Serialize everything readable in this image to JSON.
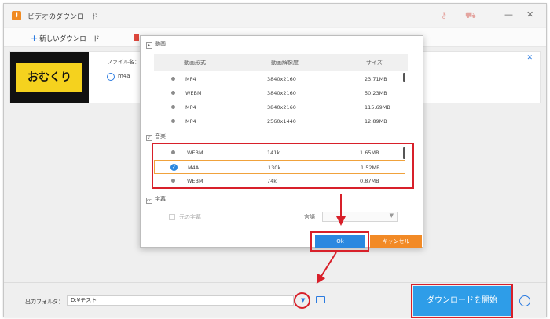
{
  "window": {
    "title": "ビデオのダウンロード",
    "app_icon": "⬇",
    "minimize": "—",
    "close": "✕"
  },
  "toolbar": {
    "new_download_label": "新しいダウンロード",
    "plus_icon": "+"
  },
  "card": {
    "thumbnail_text": "おむくり",
    "file_label": "ファイル名：【",
    "format_text": "m4a",
    "close_icon": "✕"
  },
  "dialog": {
    "video_section": "動画",
    "audio_section": "音楽",
    "subtitle_section": "字幕",
    "video_headers": {
      "format": "動画形式",
      "resolution": "動画解像度",
      "size": "サイズ"
    },
    "video_rows": [
      {
        "format": "MP4",
        "resolution": "3840x2160",
        "size": "23.71MB"
      },
      {
        "format": "WEBM",
        "resolution": "3840x2160",
        "size": "50.23MB"
      },
      {
        "format": "MP4",
        "resolution": "3840x2160",
        "size": "115.69MB"
      },
      {
        "format": "MP4",
        "resolution": "2560x1440",
        "size": "12.89MB"
      }
    ],
    "audio_rows": [
      {
        "format": "WEBM",
        "bitrate": "141k",
        "size": "1.65MB",
        "selected": false
      },
      {
        "format": "M4A",
        "bitrate": "130k",
        "size": "1.52MB",
        "selected": true
      },
      {
        "format": "WEBM",
        "bitrate": "74k",
        "size": "0.87MB",
        "selected": false
      }
    ],
    "original_subtitle_label": "元の字幕",
    "language_label": "言語",
    "language_value": "",
    "ok_label": "Ok",
    "cancel_label": "キャンセル"
  },
  "bottom": {
    "output_folder_label": "出力フォルダ：",
    "output_folder_value": "D:¥テスト",
    "start_button_label": "ダウンロードを開始"
  },
  "colors": {
    "accent_blue": "#2e9de8",
    "cancel_orange": "#f28a26",
    "highlight_red": "#d8202a"
  }
}
